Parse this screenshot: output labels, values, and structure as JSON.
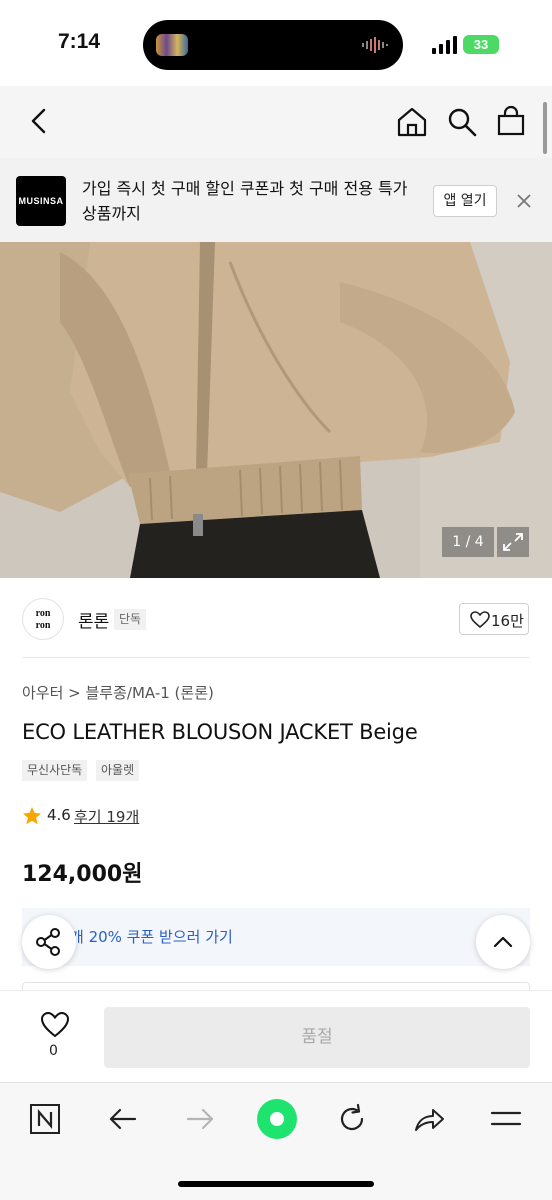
{
  "status_bar": {
    "time": "7:14",
    "battery": "33"
  },
  "header": {
    "icons": [
      "back-arrow-icon",
      "home-icon",
      "search-icon",
      "shopping-bag-icon"
    ]
  },
  "banner": {
    "logo_text": "MUSINSA",
    "message": "가입 즉시 첫 구매 할인 쿠폰과 첫 구매 전용 특가 상품까지",
    "open_app_label": "앱 열기"
  },
  "gallery": {
    "counter": "1 / 4"
  },
  "brand": {
    "logo_text_1": "ron",
    "logo_text_2": "ron",
    "name": "론론",
    "tag": "단독",
    "like_count": "16만"
  },
  "product": {
    "breadcrumb": "아우터 > 블루종/MA-1 (론론)",
    "title": "ECO LEATHER BLOUSON JACKET Beige",
    "tags": [
      "무신사단독",
      "아울렛"
    ],
    "rating": "4.6",
    "reviews": "후기 19개",
    "price": "124,000원"
  },
  "coupon": {
    "text": "개 20% 쿠폰 받으러 가기"
  },
  "purchase": {
    "like_count": "0",
    "button_label": "품절"
  },
  "colors": {
    "accent_green": "#1ee36f",
    "coupon_blue": "#2a5fc4",
    "star": "#f7a600"
  }
}
